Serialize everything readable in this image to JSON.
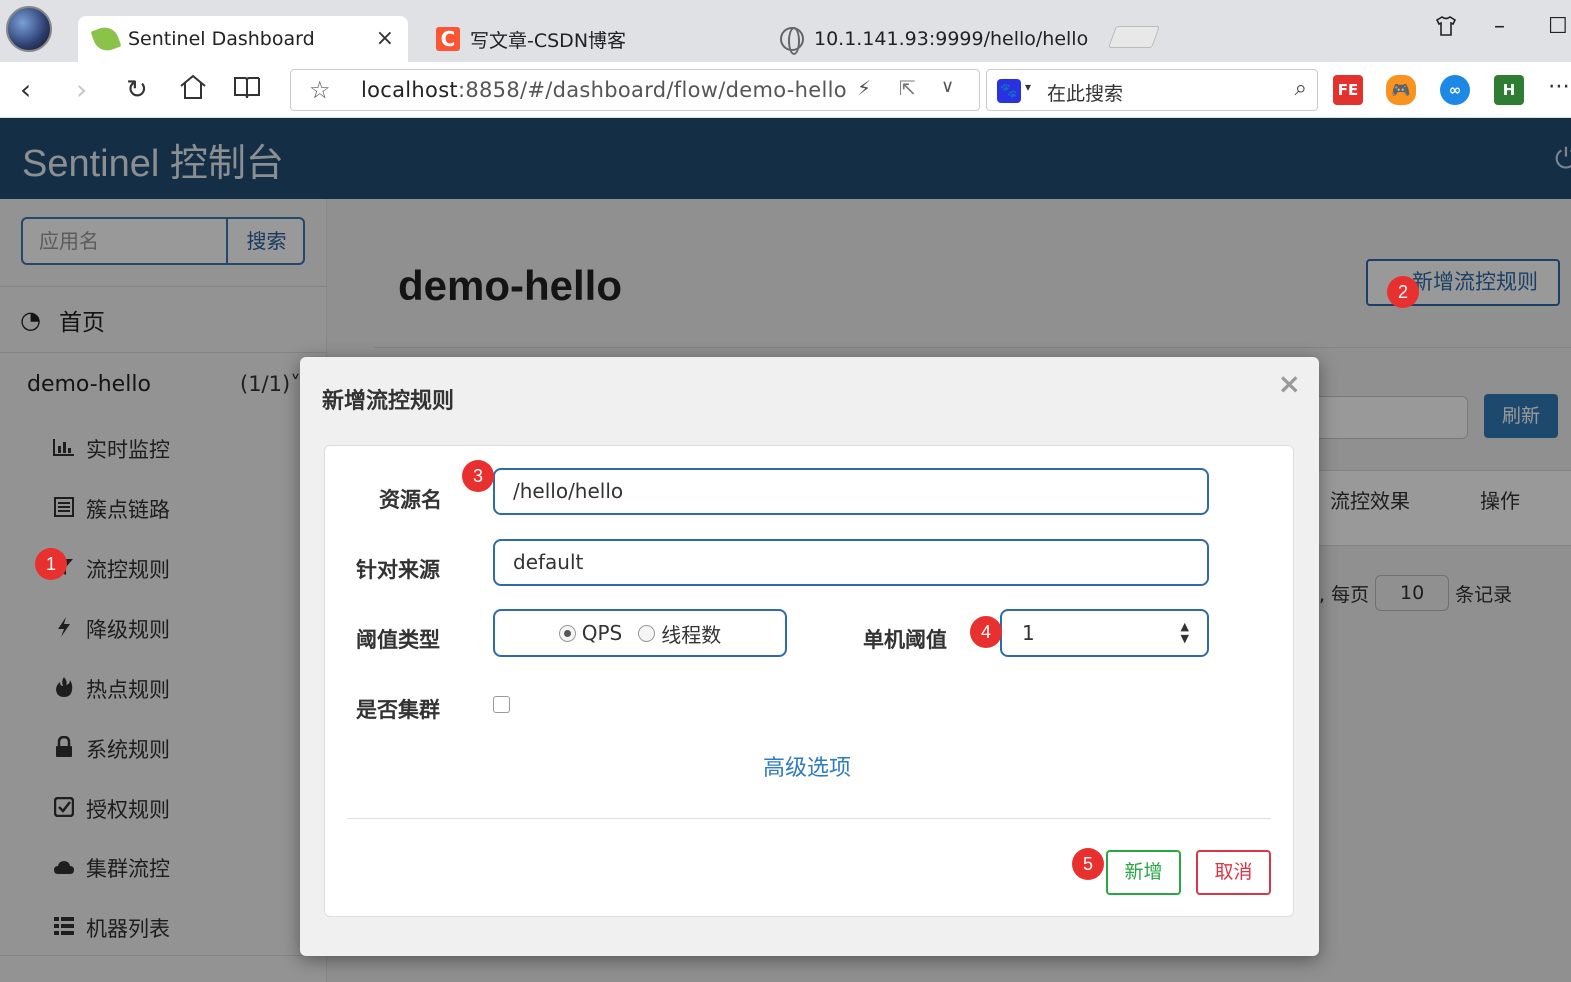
{
  "browser": {
    "tabs": [
      {
        "title": "Sentinel Dashboard",
        "close": "×"
      },
      {
        "title": "写文章-CSDN博客",
        "icon_letter": "C"
      },
      {
        "title": "10.1.141.93:9999/hello/hello"
      }
    ],
    "address": {
      "host": "localhost",
      "rest": ":8858/#/dashboard/flow/demo-hello"
    },
    "search_placeholder": "在此搜索",
    "extensions": {
      "fe": "FE",
      "h": "H"
    }
  },
  "app": {
    "title": "Sentinel 控制台"
  },
  "sidebar": {
    "search_placeholder": "应用名",
    "search_button": "搜索",
    "home": "首页",
    "app_name": "demo-hello",
    "app_count": "(1/1)",
    "items": [
      {
        "label": "实时监控",
        "icon": "bar-chart-icon"
      },
      {
        "label": "簇点链路",
        "icon": "list-icon"
      },
      {
        "label": "流控规则",
        "icon": "filter-icon"
      },
      {
        "label": "降级规则",
        "icon": "flash-icon"
      },
      {
        "label": "热点规则",
        "icon": "fire-icon"
      },
      {
        "label": "系统规则",
        "icon": "lock-icon"
      },
      {
        "label": "授权规则",
        "icon": "check-square-icon"
      },
      {
        "label": "集群流控",
        "icon": "cloud-icon"
      },
      {
        "label": "机器列表",
        "icon": "th-list-icon"
      }
    ]
  },
  "main": {
    "title": "demo-hello",
    "add_rule_button": "新增流控规则",
    "refresh_button": "刷新",
    "columns": [
      "流控效果",
      "操作"
    ],
    "pager": {
      "prefix": "录, 每页",
      "page_size": "10",
      "suffix": "条记录"
    }
  },
  "modal": {
    "title": "新增流控规则",
    "close": "×",
    "fields": {
      "resource_label": "资源名",
      "resource_value": "/hello/hello",
      "origin_label": "针对来源",
      "origin_value": "default",
      "grade_label": "阈值类型",
      "grade_options": [
        "QPS",
        "线程数"
      ],
      "grade_selected": "QPS",
      "threshold_label": "单机阈值",
      "threshold_value": "1",
      "cluster_label": "是否集群",
      "cluster_checked": false
    },
    "advanced_link": "高级选项",
    "save_button": "新增",
    "cancel_button": "取消"
  },
  "annotations": [
    "1",
    "2",
    "3",
    "4",
    "5"
  ]
}
